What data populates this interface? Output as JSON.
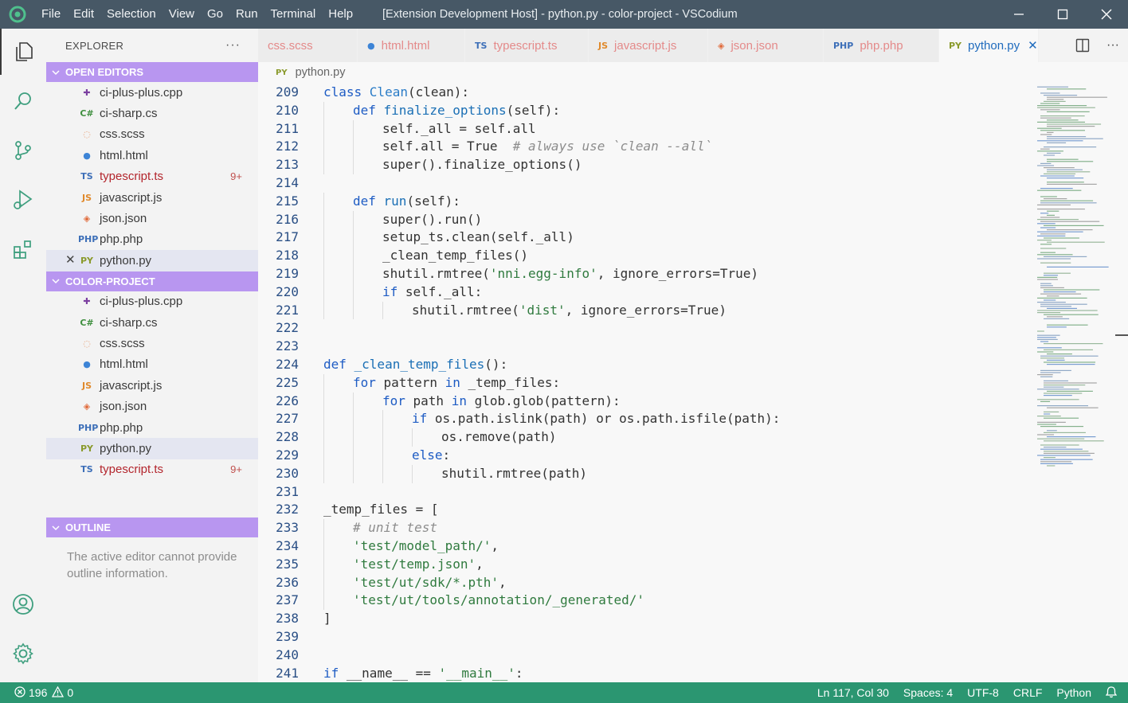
{
  "titlebar": {
    "menus": [
      "File",
      "Edit",
      "Selection",
      "View",
      "Go",
      "Run",
      "Terminal",
      "Help"
    ],
    "title": "[Extension Development Host] - python.py - color-project - VSCodium"
  },
  "sidebar": {
    "title": "EXPLORER",
    "more": "···",
    "open_editors_label": "OPEN EDITORS",
    "project_label": "COLOR-PROJECT",
    "outline_label": "OUTLINE",
    "outline_message": "The active editor cannot provide outline information.",
    "open_editors": [
      {
        "icon": "✚",
        "icon_color": "#7b3fa0",
        "name": "ci-plus-plus.cpp"
      },
      {
        "icon": "C#",
        "icon_color": "#3f8f3f",
        "name": "ci-sharp.cs"
      },
      {
        "icon": "◌",
        "icon_color": "#e8a37a",
        "name": "css.scss"
      },
      {
        "icon": "●",
        "icon_color": "#3d84d6",
        "name": "html.html"
      },
      {
        "icon": "TS",
        "icon_color": "#3d6fb8",
        "name": "typescript.ts",
        "badge": "9+",
        "error": true
      },
      {
        "icon": "JS",
        "icon_color": "#e08a2c",
        "name": "javascript.js"
      },
      {
        "icon": "◈",
        "icon_color": "#e06a3a",
        "name": "json.json"
      },
      {
        "icon": "PHP",
        "icon_color": "#3d6fb8",
        "name": "php.php"
      },
      {
        "icon": "PY",
        "icon_color": "#8a9a2c",
        "name": "python.py",
        "close": "✕",
        "selected": true
      }
    ],
    "project_files": [
      {
        "icon": "✚",
        "icon_color": "#7b3fa0",
        "name": "ci-plus-plus.cpp"
      },
      {
        "icon": "C#",
        "icon_color": "#3f8f3f",
        "name": "ci-sharp.cs"
      },
      {
        "icon": "◌",
        "icon_color": "#e8a37a",
        "name": "css.scss"
      },
      {
        "icon": "●",
        "icon_color": "#3d84d6",
        "name": "html.html"
      },
      {
        "icon": "JS",
        "icon_color": "#e08a2c",
        "name": "javascript.js"
      },
      {
        "icon": "◈",
        "icon_color": "#e06a3a",
        "name": "json.json"
      },
      {
        "icon": "PHP",
        "icon_color": "#3d6fb8",
        "name": "php.php"
      },
      {
        "icon": "PY",
        "icon_color": "#8a9a2c",
        "name": "python.py",
        "selected": true
      },
      {
        "icon": "TS",
        "icon_color": "#3d6fb8",
        "name": "typescript.ts",
        "badge": "9+",
        "error": true
      }
    ]
  },
  "tabs": [
    {
      "icon": "",
      "icon_color": "#e48a8a",
      "label": "css.scss",
      "width": 1
    },
    {
      "icon": "●",
      "icon_color": "#3d84d6",
      "label": "html.html",
      "width": 2
    },
    {
      "icon": "TS",
      "icon_color": "#3d6fb8",
      "label": "typescript.ts",
      "width": 3
    },
    {
      "icon": "JS",
      "icon_color": "#e08a2c",
      "label": "javascript.js",
      "width": 4
    },
    {
      "icon": "◈",
      "icon_color": "#e06a3a",
      "label": "json.json",
      "width": 5
    },
    {
      "icon": "PHP",
      "icon_color": "#3d6fb8",
      "label": "php.php",
      "width": 6
    },
    {
      "icon": "PY",
      "icon_color": "#8a9a2c",
      "label": "python.py",
      "active": true,
      "close": "✕",
      "width": 7
    }
  ],
  "breadcrumb": {
    "icon": "PY",
    "label": "python.py"
  },
  "code": {
    "lines": [
      {
        "n": "209",
        "indent": 0,
        "t": [
          [
            "kw",
            "class "
          ],
          [
            "cls",
            "Clean"
          ],
          [
            "",
            "(clean):"
          ]
        ]
      },
      {
        "n": "210",
        "indent": 1,
        "t": [
          [
            "kw",
            "def "
          ],
          [
            "fn",
            "finalize_options"
          ],
          [
            "",
            "(self):"
          ]
        ]
      },
      {
        "n": "211",
        "indent": 2,
        "t": [
          [
            "",
            "self._all = self.all"
          ]
        ]
      },
      {
        "n": "212",
        "indent": 2,
        "t": [
          [
            "",
            "self.all = True  "
          ],
          [
            "cm",
            "# always use `clean --all`"
          ]
        ]
      },
      {
        "n": "213",
        "indent": 2,
        "t": [
          [
            "",
            "super().finalize_options()"
          ]
        ]
      },
      {
        "n": "214",
        "indent": 0,
        "t": []
      },
      {
        "n": "215",
        "indent": 1,
        "t": [
          [
            "kw",
            "def "
          ],
          [
            "fn",
            "run"
          ],
          [
            "",
            "(self):"
          ]
        ]
      },
      {
        "n": "216",
        "indent": 2,
        "t": [
          [
            "",
            "super().run()"
          ]
        ]
      },
      {
        "n": "217",
        "indent": 2,
        "t": [
          [
            "",
            "setup_ts.clean(self._all)"
          ]
        ]
      },
      {
        "n": "218",
        "indent": 2,
        "t": [
          [
            "",
            "_clean_temp_files()"
          ]
        ]
      },
      {
        "n": "219",
        "indent": 2,
        "t": [
          [
            "",
            "shutil.rmtree("
          ],
          [
            "str",
            "'nni.egg-info'"
          ],
          [
            "",
            ", ignore_errors=True)"
          ]
        ]
      },
      {
        "n": "220",
        "indent": 2,
        "t": [
          [
            "kw",
            "if "
          ],
          [
            "",
            "self._all:"
          ]
        ]
      },
      {
        "n": "221",
        "indent": 3,
        "t": [
          [
            "",
            "shutil.rmtree("
          ],
          [
            "str",
            "'dist'"
          ],
          [
            "",
            ", ignore_errors=True)"
          ]
        ]
      },
      {
        "n": "222",
        "indent": 0,
        "t": []
      },
      {
        "n": "223",
        "indent": 0,
        "t": []
      },
      {
        "n": "224",
        "indent": 0,
        "t": [
          [
            "kw",
            "def "
          ],
          [
            "fn",
            "_clean_temp_files"
          ],
          [
            "",
            "():"
          ]
        ]
      },
      {
        "n": "225",
        "indent": 1,
        "t": [
          [
            "kw",
            "for "
          ],
          [
            "",
            "pattern "
          ],
          [
            "kw",
            "in "
          ],
          [
            "",
            "_temp_files:"
          ]
        ]
      },
      {
        "n": "226",
        "indent": 2,
        "t": [
          [
            "kw",
            "for "
          ],
          [
            "",
            "path "
          ],
          [
            "kw",
            "in "
          ],
          [
            "",
            "glob.glob(pattern):"
          ]
        ]
      },
      {
        "n": "227",
        "indent": 3,
        "t": [
          [
            "kw",
            "if "
          ],
          [
            "",
            "os.path.islink(path) or os.path.isfile(path):"
          ]
        ]
      },
      {
        "n": "228",
        "indent": 4,
        "t": [
          [
            "",
            "os.remove(path)"
          ]
        ]
      },
      {
        "n": "229",
        "indent": 3,
        "t": [
          [
            "kw",
            "else"
          ],
          [
            "",
            ":"
          ]
        ]
      },
      {
        "n": "230",
        "indent": 4,
        "t": [
          [
            "",
            "shutil.rmtree(path)"
          ]
        ]
      },
      {
        "n": "231",
        "indent": 0,
        "t": []
      },
      {
        "n": "232",
        "indent": 0,
        "t": [
          [
            "",
            "_temp_files = ["
          ]
        ]
      },
      {
        "n": "233",
        "indent": 1,
        "t": [
          [
            "cm",
            "# unit test"
          ]
        ]
      },
      {
        "n": "234",
        "indent": 1,
        "t": [
          [
            "str",
            "'test/model_path/'"
          ],
          [
            "",
            ","
          ]
        ]
      },
      {
        "n": "235",
        "indent": 1,
        "t": [
          [
            "str",
            "'test/temp.json'"
          ],
          [
            "",
            ","
          ]
        ]
      },
      {
        "n": "236",
        "indent": 1,
        "t": [
          [
            "str",
            "'test/ut/sdk/*.pth'"
          ],
          [
            "",
            ","
          ]
        ]
      },
      {
        "n": "237",
        "indent": 1,
        "t": [
          [
            "str",
            "'test/ut/tools/annotation/_generated/'"
          ]
        ]
      },
      {
        "n": "238",
        "indent": 0,
        "t": [
          [
            "",
            "]"
          ]
        ]
      },
      {
        "n": "239",
        "indent": 0,
        "t": []
      },
      {
        "n": "240",
        "indent": 0,
        "t": []
      },
      {
        "n": "241",
        "indent": 0,
        "t": [
          [
            "kw",
            "if "
          ],
          [
            "",
            "__name__ == "
          ],
          [
            "str",
            "'__main__'"
          ],
          [
            "",
            ":"
          ]
        ]
      }
    ]
  },
  "statusbar": {
    "errors": "196",
    "warnings": "0",
    "cursor": "Ln 117, Col 30",
    "spaces": "Spaces: 4",
    "encoding": "UTF-8",
    "eol": "CRLF",
    "language": "Python"
  },
  "colors": {
    "accent": "#b896f0",
    "status": "#2b9671",
    "titlebar": "#475866"
  }
}
